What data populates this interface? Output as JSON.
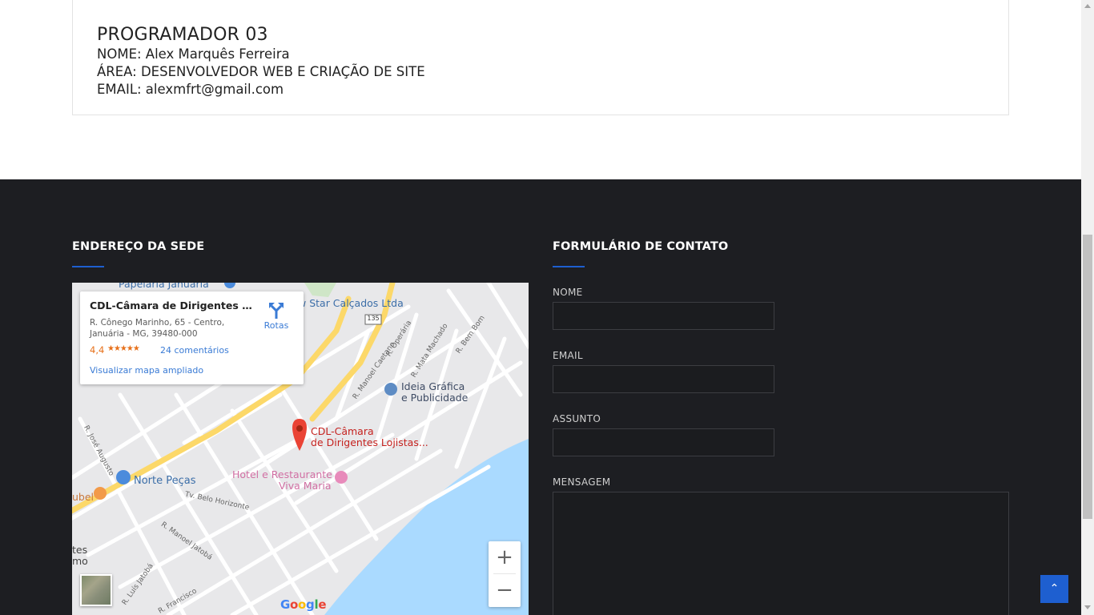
{
  "programmer": {
    "title": "PROGRAMADOR 03",
    "name_line": "NOME: Alex Marquês Ferreira",
    "area_line": "ÁREA: DESENVOLVEDOR WEB E CRIAÇÃO DE SITE",
    "email_line": "EMAIL: alexmfrt@gmail.com"
  },
  "address": {
    "title": "ENDEREÇO DA SEDE"
  },
  "map": {
    "place_name": "CDL-Câmara de Dirigentes Loj...",
    "address_line1": "R. Cônego Marinho, 65 - Centro,",
    "address_line2": "Januária - MG, 39480-000",
    "rating": "4,4",
    "stars": "★★★★★",
    "reviews": "24 comentários",
    "directions": "Rotas",
    "enlarge": "Visualizar mapa ampliado",
    "pin_label_1": "CDL-Câmara",
    "pin_label_2": "de Dirigentes Lojistas...",
    "poi_papelaria": "Papelaria Januária",
    "poi_calcados": "w Star Calçados Ltda",
    "poi_grafica_1": "Ideia Gráfica",
    "poi_grafica_2": "e Publicidade",
    "poi_pecas": "Norte Peças",
    "poi_hotel_1": "Hotel e Restaurante",
    "poi_hotel_2": "Viva Maria",
    "poi_bel": "ubel",
    "poi_tes": "tes",
    "poi_mo": "mo",
    "route_shield": "135",
    "streets": [
      "R. Operária",
      "R. Mata Machado",
      "R. Bem Bom",
      "R. Manoel Caetano",
      "R. José Augusto",
      "Tv. Belo Horizonte",
      "R. Manoel Jatobá",
      "R. Luís Jatobá",
      "R. Francisco"
    ],
    "zoom_in": "+",
    "zoom_out": "−",
    "google": [
      "G",
      "o",
      "o",
      "g",
      "l",
      "e"
    ],
    "colors": {
      "road": "#ffffff",
      "highway": "#fcd869",
      "water": "#aadaff",
      "land": "#e8e8ea",
      "pin": "#ea4335"
    }
  },
  "contact": {
    "title": "FORMULÁRIO DE CONTATO",
    "name_label": "NOME",
    "email_label": "EMAIL",
    "subject_label": "ASSUNTO",
    "message_label": "MENSAGEM",
    "name_value": "",
    "email_value": "",
    "subject_value": "",
    "message_value": ""
  },
  "back_to_top": "⌃",
  "colors": {
    "accent": "#1e5fd0",
    "footer_bg": "#1d1e22"
  }
}
